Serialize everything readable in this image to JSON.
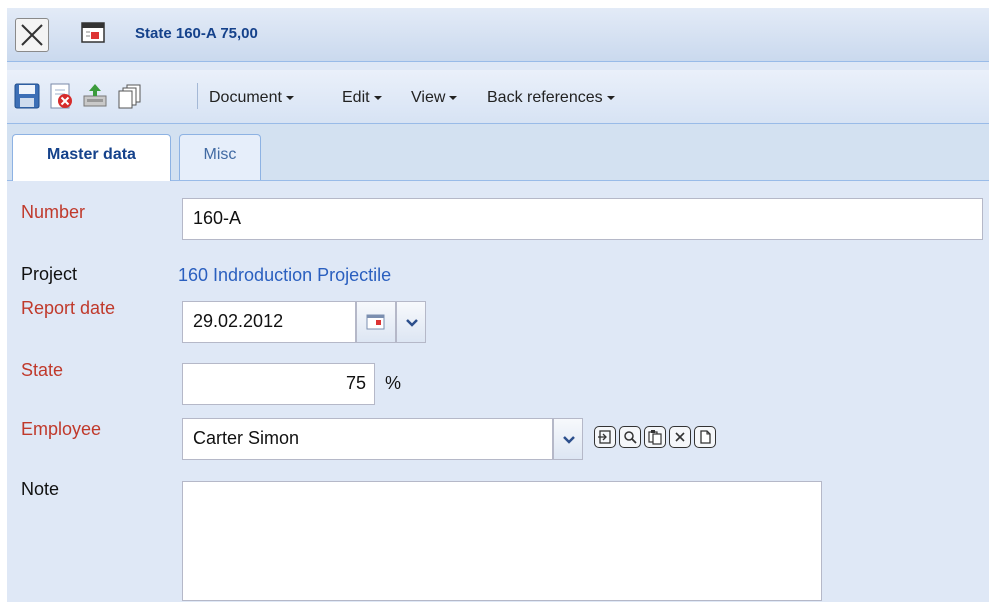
{
  "window": {
    "title": "State 160-A 75,00"
  },
  "toolbar": {
    "icons": [
      "save-icon",
      "delete-icon",
      "export-icon",
      "copy-icon"
    ],
    "menus": [
      "Document",
      "Edit",
      "View",
      "Back references"
    ]
  },
  "tabs": [
    {
      "label": "Master data",
      "active": true
    },
    {
      "label": "Misc",
      "active": false
    }
  ],
  "form": {
    "number": {
      "label": "Number",
      "value": "160-A"
    },
    "project": {
      "label": "Project",
      "value": "160 Indroduction Projectile"
    },
    "report_date": {
      "label": "Report date",
      "value": "29.02.2012"
    },
    "state": {
      "label": "State",
      "value": "75",
      "unit": "%"
    },
    "employee": {
      "label": "Employee",
      "value": "Carter Simon"
    },
    "note": {
      "label": "Note",
      "value": ""
    }
  },
  "colors": {
    "required_label": "#c0392b",
    "link": "#2a5fbf",
    "title": "#15428b",
    "background": "#dfe8f6"
  }
}
